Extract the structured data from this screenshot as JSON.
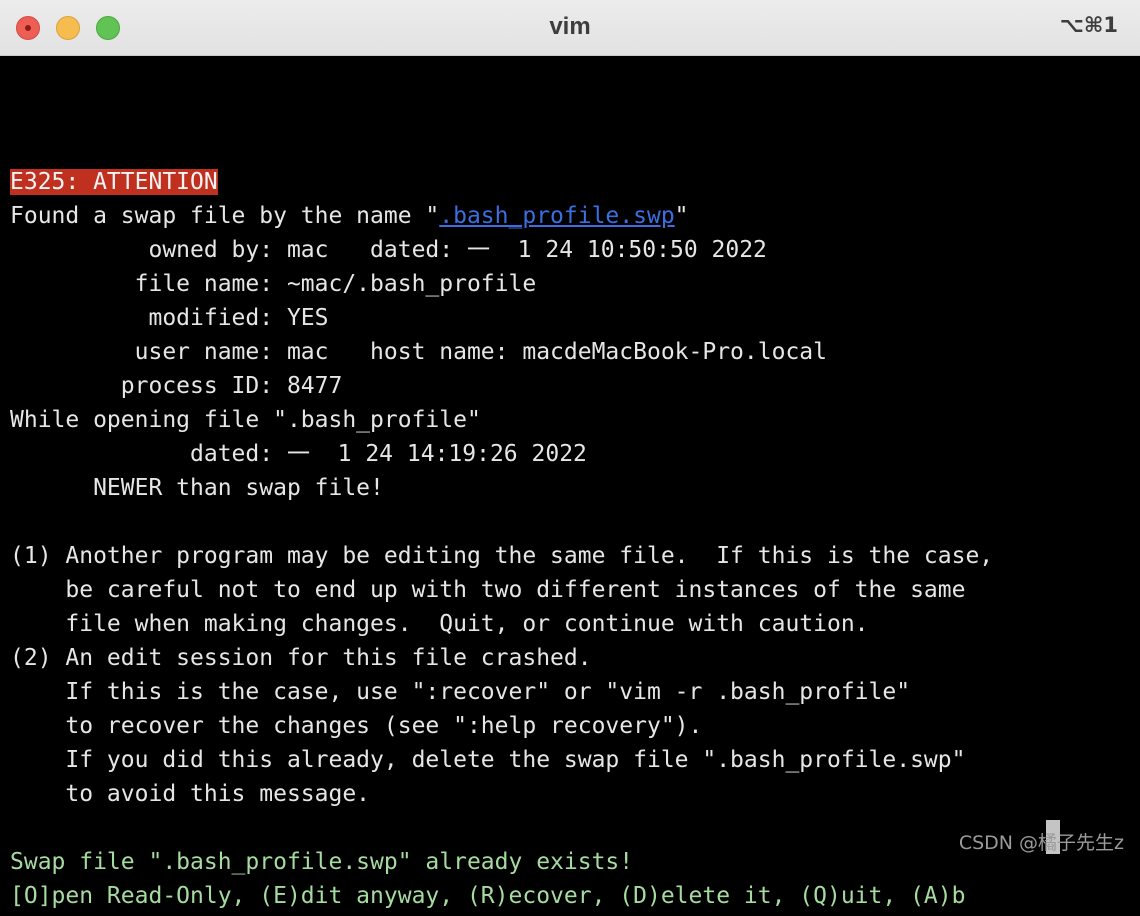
{
  "window": {
    "title": "vim",
    "shortcut": "⌥⌘1"
  },
  "terminal": {
    "attention": "E325: ATTENTION",
    "found_prefix": "Found a swap file by the name \"",
    "swap_name": ".bash_profile.swp",
    "found_suffix": "\"",
    "owned_by": "          owned by: mac   dated: 一  1 24 10:50:50 2022",
    "file_name": "         file name: ~mac/.bash_profile",
    "modified": "          modified: YES",
    "user_name": "         user name: mac   host name: macdeMacBook-Pro.local",
    "process_id": "        process ID: 8477",
    "while_opening": "While opening file \".bash_profile\"",
    "dated": "             dated: 一  1 24 14:19:26 2022",
    "newer": "      NEWER than swap file!",
    "opt1_line1": "(1) Another program may be editing the same file.  If this is the case,",
    "opt1_line2": "    be careful not to end up with two different instances of the same",
    "opt1_line3": "    file when making changes.  Quit, or continue with caution.",
    "opt2_line1": "(2) An edit session for this file crashed.",
    "opt2_line2": "    If this is the case, use \":recover\" or \"vim -r .bash_profile\"",
    "opt2_line3": "    to recover the changes (see \":help recovery\").",
    "opt2_line4": "    If you did this already, delete the swap file \".bash_profile.swp\"",
    "opt2_line5": "    to avoid this message.",
    "exists": "Swap file \".bash_profile.swp\" already exists!",
    "prompt": "[O]pen Read-Only, (E)dit anyway, (R)ecover, (D)elete it, (Q)uit, (A)b"
  },
  "watermark": "CSDN @橘子先生z",
  "colors": {
    "attention_bg": "#c0301f",
    "link": "#3b6fe0",
    "prompt_green": "#a6dba0",
    "terminal_bg": "#000000"
  }
}
